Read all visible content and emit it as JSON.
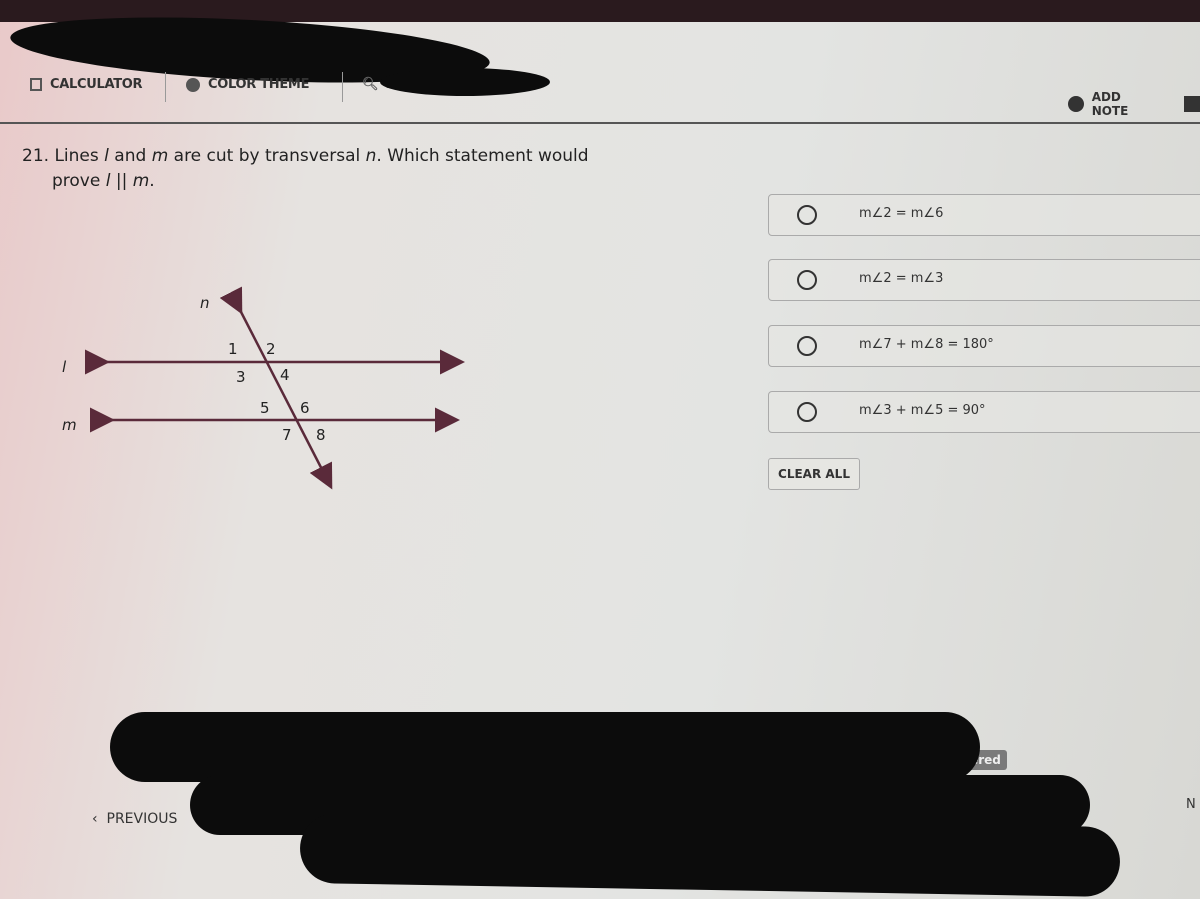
{
  "toolbar": {
    "calculator_label": "CALCULATOR",
    "color_theme_label": "COLOR THEME",
    "zoom_label": "ZOOM",
    "add_note_label": "ADD NOTE"
  },
  "question": {
    "number": "21.",
    "text_parts": [
      "Lines ",
      "l",
      " and ",
      "m",
      " are cut by transversal ",
      "n",
      ".  Which statement would"
    ],
    "text_line2": [
      "prove ",
      "l",
      " || ",
      "m",
      "."
    ]
  },
  "diagram": {
    "line_labels": {
      "l": "l",
      "m": "m",
      "n": "n"
    },
    "angle_labels": [
      "1",
      "2",
      "3",
      "4",
      "5",
      "6",
      "7",
      "8"
    ],
    "color": "#5a2a3a"
  },
  "options": [
    {
      "label": "m∠2 = m∠6",
      "selected": false
    },
    {
      "label": "m∠2 = m∠3",
      "selected": false
    },
    {
      "label": "m∠7 + m∠8 = 180°",
      "selected": false
    },
    {
      "label": "m∠3 + m∠5 = 90°",
      "selected": false
    }
  ],
  "clear_all_label": "CLEAR ALL",
  "status_badge": "Answered",
  "nav": {
    "previous_label": "PREVIOUS",
    "next_label": "N"
  }
}
